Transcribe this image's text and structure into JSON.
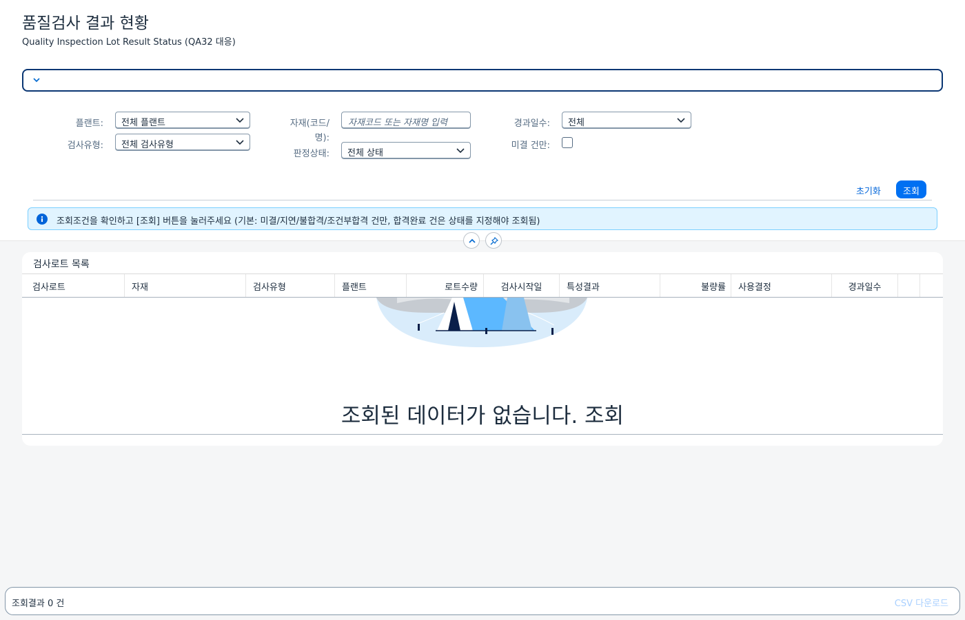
{
  "header": {
    "title": "품질검사 결과 현황",
    "subtitle": "Quality Inspection Lot Result Status (QA32 대응)"
  },
  "filters": {
    "plant_label": "플랜트:",
    "plant_value": "전체 플랜트",
    "inspection_type_label": "검사유형:",
    "inspection_type_value": "전체 검사유형",
    "material_label_line1": "자재(코드/",
    "material_label_line2": "명):",
    "material_placeholder": "자재코드 또는 자재명 입력",
    "decision_status_label": "판정상태:",
    "decision_status_value": "전체 상태",
    "elapsed_days_label": "경과일수:",
    "elapsed_days_value": "전체",
    "pending_only_label": "미결 건만:"
  },
  "actions": {
    "reset_label": "초기화",
    "search_label": "조회"
  },
  "info_message": "조회조건을 확인하고 [조회] 버튼을 눌러주세요 (기본: 미결/지연/불합격/조건부합격 건만, 합격완료 건은 상태를 지정해야 조회됨)",
  "table": {
    "title": "검사로트 목록",
    "columns": [
      "검사로트",
      "자재",
      "검사유형",
      "플랜트",
      "로트수량",
      "검사시작일",
      "특성결과",
      "불량률",
      "사용결정",
      "경과일수"
    ],
    "no_data_text": "조회된 데이터가 없습니다. 조회"
  },
  "footer": {
    "result_count": "조회결과 0 건",
    "csv_label": "CSV 다운로드"
  },
  "colors": {
    "accent": "#0070f2",
    "link": "#0064d9",
    "info_bg": "#e1f4ff",
    "info_border": "#7bcfff",
    "variant_border": "#0a3673"
  }
}
